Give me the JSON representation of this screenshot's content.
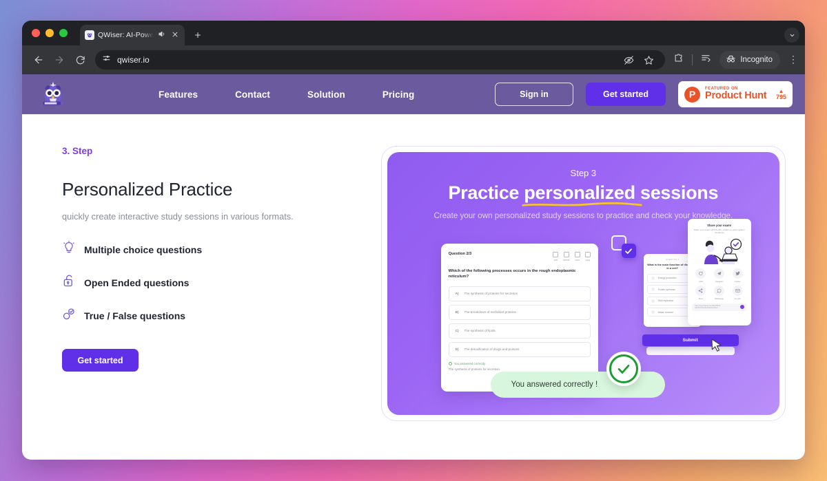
{
  "browser": {
    "tab": {
      "title": "QWiser: AI-Powered Lear",
      "favicon": "owl-icon",
      "audio_icon": "speaker-icon",
      "close_icon": "close-icon"
    },
    "new_tab_label": "+",
    "window_controls": [
      "close",
      "minimize",
      "maximize"
    ],
    "tabstrip_expand_icon": "chevron-down-icon",
    "nav": {
      "back": "back-arrow-icon",
      "forward": "forward-arrow-icon",
      "reload": "reload-icon"
    },
    "omnibox": {
      "url": "qwiser.io",
      "site_settings_icon": "tune-icon",
      "hide_icon": "eye-off-icon",
      "bookmark_icon": "star-icon"
    },
    "toolbar": {
      "extensions_icon": "puzzle-icon",
      "tab_list_icon": "list-icon",
      "profile_label": "Incognito",
      "profile_icon": "incognito-icon",
      "menu_icon": "kebab-menu-icon"
    }
  },
  "site_nav": {
    "logo_name": "qwiser-owl-logo",
    "links": [
      "Features",
      "Contact",
      "Solution",
      "Pricing"
    ],
    "sign_in": "Sign in",
    "get_started": "Get started",
    "product_hunt": {
      "featured": "FEATURED ON",
      "name": "Product Hunt",
      "triangle": "▲",
      "votes": "795"
    }
  },
  "left": {
    "step_label": "3. Step",
    "headline": "Personalized Practice",
    "subline": "quickly create interactive study sessions in various formats.",
    "features": [
      {
        "icon": "lightbulb-icon",
        "label": "Multiple choice questions"
      },
      {
        "icon": "open-lock-icon",
        "label": "Open Ended questions"
      },
      {
        "icon": "toggle-check-icon",
        "label": "True / False questions"
      }
    ],
    "cta": "Get started"
  },
  "promo": {
    "step": "Step 3",
    "title_before": "Practice ",
    "title_highlight": "personalized",
    "title_after": " sessions",
    "subtitle": "Create your own personalized study sessions to practice and check your knowledge.",
    "question_card": {
      "number": "Question 2/3",
      "tools": [
        {
          "icon": "edit-icon",
          "label": "edit"
        },
        {
          "icon": "delete-icon",
          "label": "delete"
        },
        {
          "icon": "save-icon",
          "label": "save"
        },
        {
          "icon": "copy-icon",
          "label": "copy"
        }
      ],
      "question": "Which of the following processes occurs in the rough endoplasmic reticulum?",
      "options": [
        {
          "key": "A)",
          "text": "The synthesis of proteins for secretion"
        },
        {
          "key": "B)",
          "text": "The breakdown of misfolded proteins"
        },
        {
          "key": "C)",
          "text": "The synthesis of lipids"
        },
        {
          "key": "D)",
          "text": "The detoxification of drugs and poisons"
        }
      ],
      "answer_title": "You answered correctly.",
      "answer_body": "The synthesis of proteins for secretion"
    },
    "mini_card": {
      "tag": "QUESTION 3",
      "question": "What is the main function of ribosomes in a cell?",
      "options": [
        "Energy production",
        "Protein synthesis",
        "DNA replication",
        "Waste removal"
      ]
    },
    "submit": "Submit",
    "share_card": {
      "title": "Share your exam!",
      "subtitle": "Share your exam with friends, student or exam (jaisan members)",
      "illustration": "people-with-laptop-illustration",
      "actions": [
        {
          "icon": "chat-icon",
          "label": "Chat"
        },
        {
          "icon": "telegram-icon",
          "label": "Telegram"
        },
        {
          "icon": "twitter-icon",
          "label": "Twitter"
        },
        {
          "icon": "share-icon",
          "label": "More"
        },
        {
          "icon": "whatsapp-icon",
          "label": "Whatsapp"
        },
        {
          "icon": "email-icon",
          "label": "E-mail"
        }
      ],
      "link": "https://www.figma.com/file/W5ViI-1ujPSXhCtesandxkede/Share..."
    },
    "toast": "You answered correctly !",
    "check_badge_icon": "green-check-icon",
    "cursor_icon": "mouse-pointer-icon"
  },
  "colors": {
    "brand_purple": "#6030e8",
    "nav_purple": "#6b5a9e",
    "accent_violet": "#7c3aed",
    "underline_yellow": "#f5c431",
    "success_green": "#1d9b33",
    "product_hunt_red": "#ea532a"
  }
}
